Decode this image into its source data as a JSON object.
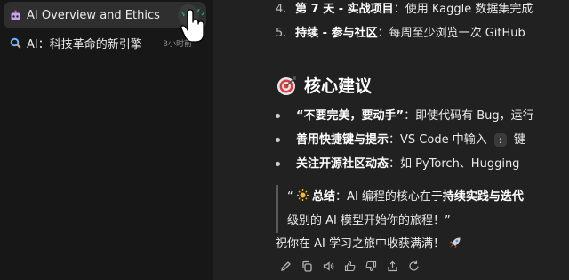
{
  "sidebar": {
    "chats": [
      {
        "title": "AI Overview and Ethics",
        "icon": "robot-icon",
        "more": "···"
      },
      {
        "title": "AI：科技革命的新引擎",
        "icon": "search-icon",
        "time": "3小时前"
      }
    ]
  },
  "main": {
    "steps": [
      {
        "num": "4.",
        "bold": "第 7 天 - 实战项目",
        "text": "：使用 Kaggle 数据集完成"
      },
      {
        "num": "5.",
        "bold": "持续 - 参与社区",
        "text": "：每周至少浏览一次 GitHub"
      }
    ],
    "heading": "核心建议",
    "tips": [
      {
        "bold": "“不要完美，要动手”",
        "text": "：即使代码有 Bug，运行"
      },
      {
        "bold": "善用快捷键与提示",
        "text_before": "：VS Code 中输入 ",
        "kbd": ":",
        "text_after": " 键"
      },
      {
        "bold": "关注开源社区动态",
        "text": "：如 PyTorch、Hugging"
      }
    ],
    "quote": {
      "open": "“",
      "bold_label": "总结",
      "text1": "：AI 编程的核心在于",
      "bold_text": "持续实践与迭代",
      "line2": "级别的 AI 模型开始你的旅程！”"
    },
    "closing": "祝你在 AI 学习之旅中收获满满！",
    "actions": [
      "edit-icon",
      "copy-icon",
      "speaker-icon",
      "thumbs-up-icon",
      "thumbs-down-icon",
      "share-icon",
      "regenerate-icon"
    ]
  }
}
